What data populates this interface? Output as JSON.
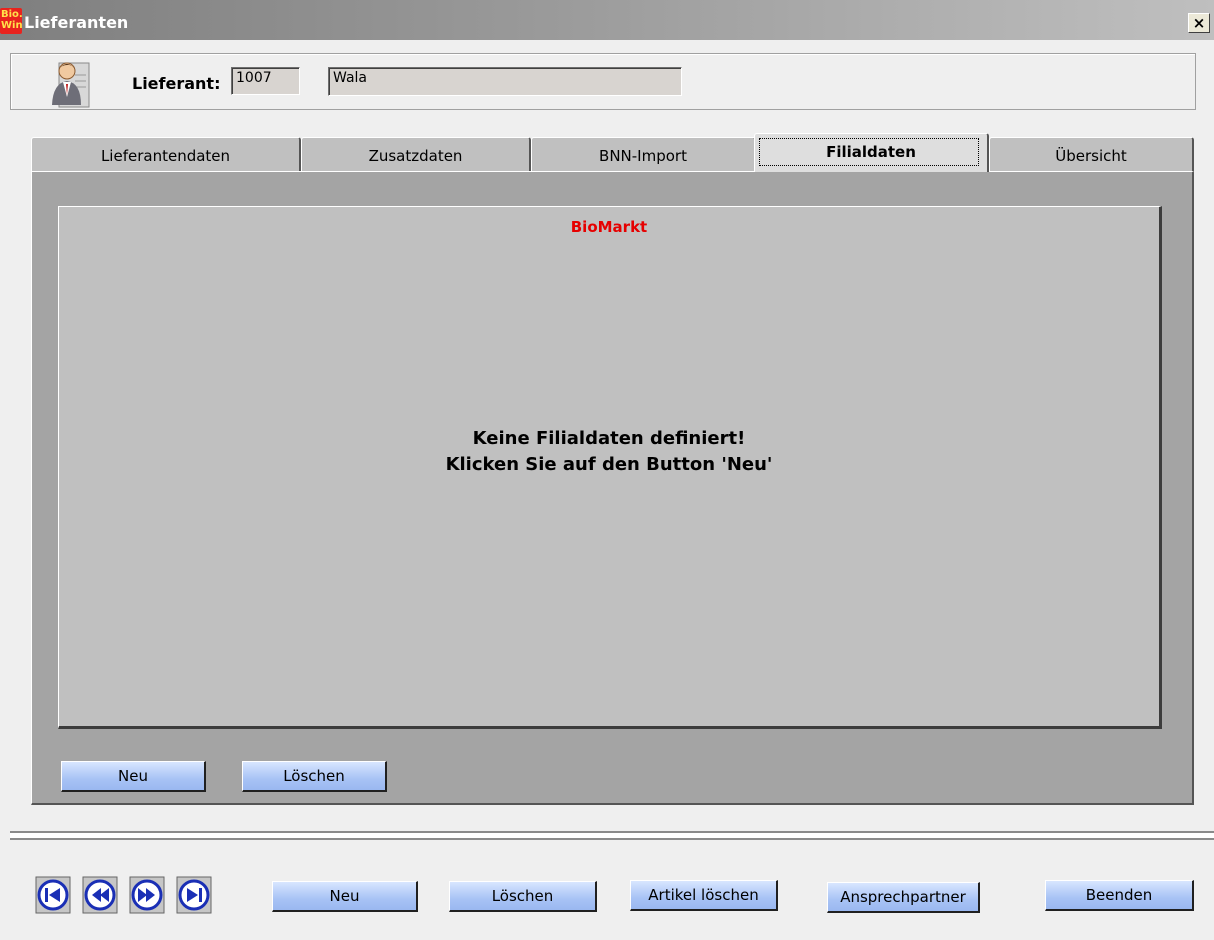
{
  "window": {
    "title": "Lieferanten",
    "logo_line1": "Bio.",
    "logo_line2": "Win",
    "close_label": "×"
  },
  "header": {
    "label": "Lieferant:",
    "number": "1007",
    "name": "Wala",
    "icon": "person-icon"
  },
  "tabs": [
    {
      "label": "Lieferantendaten",
      "active": false
    },
    {
      "label": "Zusatzdaten",
      "active": false
    },
    {
      "label": "BNN-Import",
      "active": false
    },
    {
      "label": "Filialdaten",
      "active": true
    },
    {
      "label": "Übersicht",
      "active": false
    }
  ],
  "branch": {
    "title": "BioMarkt",
    "message_line1": "Keine Filialdaten definiert!",
    "message_line2": "Klicken Sie auf den Button 'Neu'",
    "neu_label": "Neu",
    "loeschen_label": "Löschen"
  },
  "footer": {
    "nav_icons": [
      "first-record-icon",
      "previous-record-icon",
      "next-record-icon",
      "last-record-icon"
    ],
    "neu_label": "Neu",
    "loeschen_label": "Löschen",
    "artikel_loeschen_label": "Artikel löschen",
    "ansprechpartner_label": "Ansprechpartner",
    "beenden_label": "Beenden"
  },
  "colors": {
    "accent_red": "#e60000",
    "button_blue": "#a8c3f5",
    "nav_icon_blue": "#1a2fb5"
  }
}
